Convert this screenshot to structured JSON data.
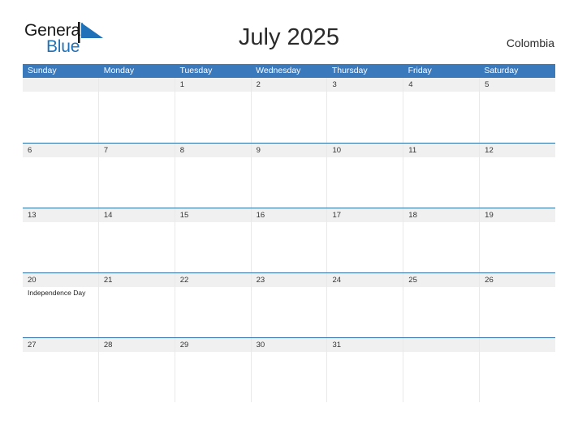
{
  "brand": {
    "name_part1": "General",
    "name_part2": "Blue",
    "flag_color": "#1f71b8",
    "text_color": "#1a1a1a"
  },
  "header": {
    "title": "July 2025",
    "country": "Colombia"
  },
  "calendar": {
    "header_bg": "#3b79bd",
    "header_text_color": "#ffffff",
    "row_border_color": "#2c6ca8",
    "date_strip_bg": "#f0f0f0",
    "weekdays": [
      "Sunday",
      "Monday",
      "Tuesday",
      "Wednesday",
      "Thursday",
      "Friday",
      "Saturday"
    ],
    "weeks": [
      [
        {
          "date": "",
          "events": []
        },
        {
          "date": "",
          "events": []
        },
        {
          "date": "1",
          "events": []
        },
        {
          "date": "2",
          "events": []
        },
        {
          "date": "3",
          "events": []
        },
        {
          "date": "4",
          "events": []
        },
        {
          "date": "5",
          "events": []
        }
      ],
      [
        {
          "date": "6",
          "events": []
        },
        {
          "date": "7",
          "events": []
        },
        {
          "date": "8",
          "events": []
        },
        {
          "date": "9",
          "events": []
        },
        {
          "date": "10",
          "events": []
        },
        {
          "date": "11",
          "events": []
        },
        {
          "date": "12",
          "events": []
        }
      ],
      [
        {
          "date": "13",
          "events": []
        },
        {
          "date": "14",
          "events": []
        },
        {
          "date": "15",
          "events": []
        },
        {
          "date": "16",
          "events": []
        },
        {
          "date": "17",
          "events": []
        },
        {
          "date": "18",
          "events": []
        },
        {
          "date": "19",
          "events": []
        }
      ],
      [
        {
          "date": "20",
          "events": [
            "Independence Day"
          ]
        },
        {
          "date": "21",
          "events": []
        },
        {
          "date": "22",
          "events": []
        },
        {
          "date": "23",
          "events": []
        },
        {
          "date": "24",
          "events": []
        },
        {
          "date": "25",
          "events": []
        },
        {
          "date": "26",
          "events": []
        }
      ],
      [
        {
          "date": "27",
          "events": []
        },
        {
          "date": "28",
          "events": []
        },
        {
          "date": "29",
          "events": []
        },
        {
          "date": "30",
          "events": []
        },
        {
          "date": "31",
          "events": []
        },
        {
          "date": "",
          "events": []
        },
        {
          "date": "",
          "events": []
        }
      ]
    ]
  }
}
